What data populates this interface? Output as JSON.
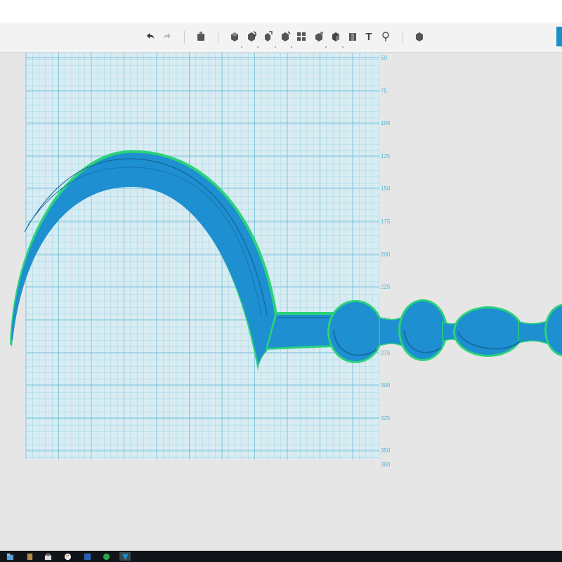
{
  "toolbar": {
    "undo_icon": "undo-arrow-icon",
    "redo_icon": "redo-arrow-icon",
    "text_tool_label": "T"
  },
  "grid": {
    "y_tick_labels": [
      "50",
      "75",
      "100",
      "125",
      "150",
      "175",
      "200",
      "225",
      "250",
      "275",
      "300",
      "325",
      "350",
      "360"
    ]
  },
  "colors": {
    "model_blue": "#1e8fd0",
    "model_outline": "#2bd27a",
    "grid_line": "#9fd6e6",
    "grid_bg": "#d8ecf2",
    "accent": "#1a8fc8",
    "taskbar": "#111418"
  },
  "taskbar": {
    "icons": [
      "file-explorer-icon",
      "app-icon",
      "store-icon",
      "paint-icon",
      "word-icon",
      "app-green-icon",
      "3d-builder-icon"
    ]
  }
}
